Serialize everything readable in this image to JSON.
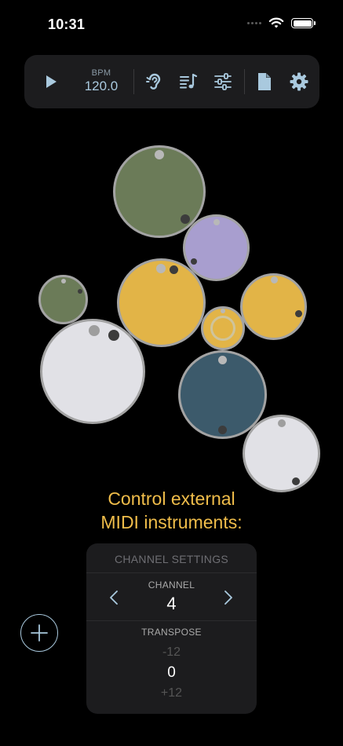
{
  "status_bar": {
    "time": "10:31"
  },
  "toolbar": {
    "bpm_label": "BPM",
    "bpm_value": "120.0",
    "accent_color": "#a9c9de"
  },
  "circles": [
    {
      "name": "circle-green-large",
      "color": "#6b7b58"
    },
    {
      "name": "circle-purple",
      "color": "#a89ecf"
    },
    {
      "name": "circle-green-small",
      "color": "#6b7b58"
    },
    {
      "name": "circle-yellow-large",
      "color": "#e2b447"
    },
    {
      "name": "circle-yellow-right",
      "color": "#e2b447"
    },
    {
      "name": "circle-yellow-small",
      "color": "#e2b447"
    },
    {
      "name": "circle-white-large",
      "color": "#e1e1e6"
    },
    {
      "name": "circle-teal",
      "color": "#3c5a6b"
    },
    {
      "name": "circle-white-small",
      "color": "#e1e1e6"
    }
  ],
  "caption": {
    "line1": "Control external",
    "line2": "MIDI instruments:",
    "color": "#f0bd4a"
  },
  "panel": {
    "title": "CHANNEL SETTINGS",
    "channel_label": "CHANNEL",
    "channel_value": "4",
    "transpose_label": "TRANSPOSE",
    "transpose_prev": "-12",
    "transpose_value": "0",
    "transpose_next": "+12"
  }
}
